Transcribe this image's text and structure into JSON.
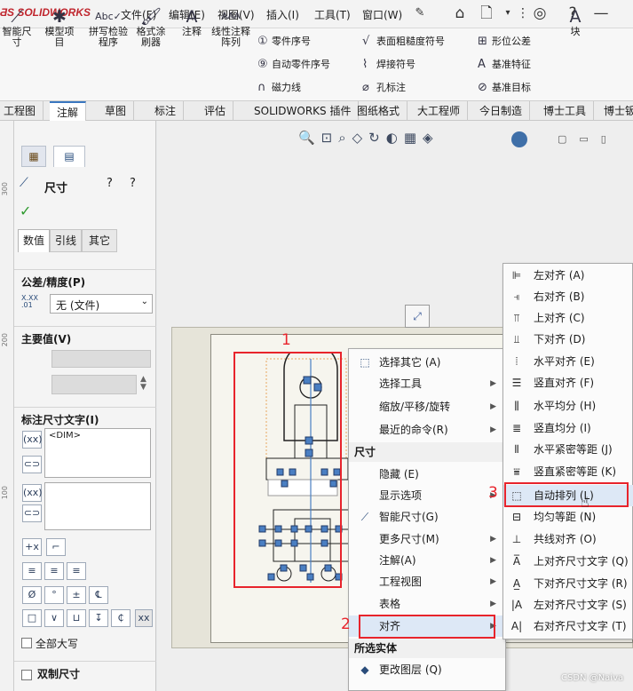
{
  "app": {
    "logo": "SOLIDWORKS"
  },
  "menu": [
    "文件(F)",
    "编辑(E)",
    "视图(V)",
    "插入(I)",
    "工具(T)",
    "窗口(W)"
  ],
  "ribbon": {
    "big": [
      "智能尺寸",
      "模型项目",
      "拼写检验程序",
      "格式涂刷器",
      "注释",
      "线性注释阵列",
      "块"
    ],
    "small": [
      "零件序号",
      "自动零件序号",
      "磁力线",
      "表面粗糙度符号",
      "焊接符号",
      "孔标注",
      "形位公差",
      "基准特征",
      "基准目标"
    ]
  },
  "tabs": [
    "工程图",
    "注解",
    "草图",
    "标注",
    "评估",
    "SOLIDWORKS 插件",
    "图纸格式",
    "大工程师",
    "今日制造",
    "博士工具",
    "博士钣"
  ],
  "ruler": [
    "300",
    "200",
    "100"
  ],
  "pm": {
    "title": "尺寸",
    "subtabs": [
      "数值",
      "引线",
      "其它"
    ],
    "tolerance": "公差/精度(P)",
    "tol_value": "无 (文件)",
    "primary": "主要值(V)",
    "dimtext": "标注尺寸文字(I)",
    "dim_token": "<DIM>",
    "allcaps": "全部大写",
    "dual": "双制尺寸"
  },
  "ctx": {
    "items": [
      "选择其它 (A)",
      "选择工具",
      "缩放/平移/旋转",
      "最近的命令(R)"
    ],
    "header_dim": "尺寸",
    "dim_items": [
      "隐藏 (E)",
      "显示选项",
      "智能尺寸(G)",
      "更多尺寸(M)",
      "注解(A)",
      "工程视图",
      "表格",
      "对齐"
    ],
    "header_sel": "所选实体",
    "sel_items": [
      "更改图层 (Q)"
    ]
  },
  "sub": {
    "items": [
      "左对齐 (A)",
      "右对齐 (B)",
      "上对齐 (C)",
      "下对齐 (D)",
      "水平对齐 (E)",
      "竖直对齐 (F)",
      "水平均分 (H)",
      "竖直均分 (I)",
      "水平紧密等距 (J)",
      "竖直紧密等距 (K)",
      "自动排列 (L)",
      "均匀等距 (N)",
      "共线对齐 (O)",
      "上对齐尺寸文字 (Q)",
      "下对齐尺寸文字 (R)",
      "左对齐尺寸文字 (S)",
      "右对齐尺寸文字 (T)"
    ]
  },
  "markers": [
    "1",
    "2",
    "3"
  ],
  "watermark": "CSDN @Naiva",
  "colors": {
    "accent": "#3a77c0",
    "marker": "#e8242c",
    "logo": "#c0262e"
  }
}
